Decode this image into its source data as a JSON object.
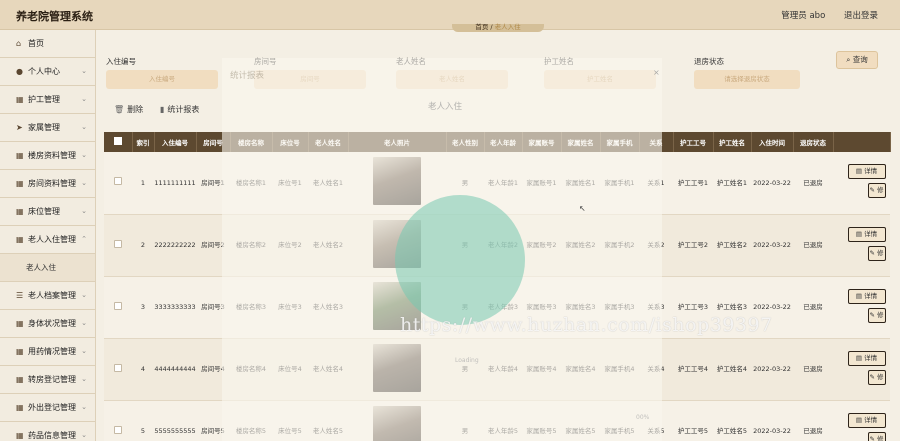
{
  "app": {
    "title": "养老院管理系统"
  },
  "header": {
    "admin_label": "管理员 abo",
    "logout": "退出登录"
  },
  "breadcrumb": {
    "home": "首页",
    "sep": "/",
    "current": "老人入住"
  },
  "sidebar": {
    "items": [
      {
        "label": "首页",
        "icon": "home-icon"
      },
      {
        "label": "个人中心",
        "icon": "user-icon"
      },
      {
        "label": "护工管理",
        "icon": "grid-icon"
      },
      {
        "label": "家属管理",
        "icon": "send-icon"
      },
      {
        "label": "楼房资料管理",
        "icon": "grid-icon"
      },
      {
        "label": "房间资料管理",
        "icon": "grid-icon"
      },
      {
        "label": "床位管理",
        "icon": "grid-icon"
      },
      {
        "label": "老人入住管理",
        "icon": "grid-icon"
      }
    ],
    "sub_item": "老人入住",
    "items_after": [
      {
        "label": "老人档案管理",
        "icon": "list-icon"
      },
      {
        "label": "身体状况管理",
        "icon": "grid-icon"
      },
      {
        "label": "用药情况管理",
        "icon": "grid-icon"
      },
      {
        "label": "转房登记管理",
        "icon": "grid-icon"
      },
      {
        "label": "外出登记管理",
        "icon": "grid-icon"
      },
      {
        "label": "药品信息管理",
        "icon": "grid-icon"
      }
    ]
  },
  "filters": {
    "checkin_no": {
      "label": "入住编号",
      "placeholder": "入住编号"
    },
    "room_no": {
      "label": "房间号",
      "placeholder": "房间号"
    },
    "elder_name": {
      "label": "老人姓名",
      "placeholder": "老人姓名"
    },
    "nurse_name": {
      "label": "护工姓名",
      "placeholder": "护工姓名"
    },
    "checkout_status": {
      "label": "退房状态",
      "placeholder": "请选择退房状态"
    },
    "search_button": "查询"
  },
  "actions": {
    "delete": "删除",
    "stats": "统计报表"
  },
  "modal": {
    "title": "统计报表",
    "close": "×",
    "subtitle": "老人入住"
  },
  "table": {
    "headers": [
      "索引",
      "入住编号",
      "房间号",
      "楼房名称",
      "床位号",
      "老人姓名",
      "老人照片",
      "老人性别",
      "老人年龄",
      "家属账号",
      "家属姓名",
      "家属手机",
      "关系",
      "护工工号",
      "护工姓名",
      "入住时间",
      "退房状态"
    ],
    "detail_label": "详情",
    "edit_label": "修改",
    "rows": [
      {
        "idx": "1",
        "no": "1111111111",
        "room": "房间号1",
        "building": "楼房名称1",
        "bed": "床位号1",
        "name": "老人姓名1",
        "gender": "男",
        "age": "老人年龄1",
        "fam_acc": "家属账号1",
        "fam_name": "家属姓名1",
        "fam_phone": "家属手机1",
        "rel": "关系1",
        "nurse_no": "护工工号1",
        "nurse_name": "护工姓名1",
        "date": "2022-03-22",
        "status": "已退房"
      },
      {
        "idx": "2",
        "no": "2222222222",
        "room": "房间号2",
        "building": "楼房名称2",
        "bed": "床位号2",
        "name": "老人姓名2",
        "gender": "男",
        "age": "老人年龄2",
        "fam_acc": "家属账号2",
        "fam_name": "家属姓名2",
        "fam_phone": "家属手机2",
        "rel": "关系2",
        "nurse_no": "护工工号2",
        "nurse_name": "护工姓名2",
        "date": "2022-03-22",
        "status": "已退房"
      },
      {
        "idx": "3",
        "no": "3333333333",
        "room": "房间号3",
        "building": "楼房名称3",
        "bed": "床位号3",
        "name": "老人姓名3",
        "gender": "男",
        "age": "老人年龄3",
        "fam_acc": "家属账号3",
        "fam_name": "家属姓名3",
        "fam_phone": "家属手机3",
        "rel": "关系3",
        "nurse_no": "护工工号3",
        "nurse_name": "护工姓名3",
        "date": "2022-03-22",
        "status": "已退房"
      },
      {
        "idx": "4",
        "no": "4444444444",
        "room": "房间号4",
        "building": "楼房名称4",
        "bed": "床位号4",
        "name": "老人姓名4",
        "gender": "男",
        "age": "老人年龄4",
        "fam_acc": "家属账号4",
        "fam_name": "家属姓名4",
        "fam_phone": "家属手机4",
        "rel": "关系4",
        "nurse_no": "护工工号4",
        "nurse_name": "护工姓名4",
        "date": "2022-03-22",
        "status": "已退房"
      },
      {
        "idx": "5",
        "no": "5555555555",
        "room": "房间号5",
        "building": "楼房名称5",
        "bed": "床位号5",
        "name": "老人姓名5",
        "gender": "男",
        "age": "老人年龄5",
        "fam_acc": "家属账号5",
        "fam_name": "家属姓名5",
        "fam_phone": "家属手机5",
        "rel": "关系5",
        "nurse_no": "护工工号5",
        "nurse_name": "护工姓名5",
        "date": "2022-03-22",
        "status": "已退房"
      }
    ]
  },
  "watermark": "https://www.huzhan.com/ishop39397",
  "ghost_labels": [
    "Loading",
    "00%"
  ],
  "colors": {
    "header_bg": "#e7d7bc",
    "table_header": "#5d4930",
    "input_bg": "#f1ddc0",
    "circle": "#76c8b0"
  }
}
